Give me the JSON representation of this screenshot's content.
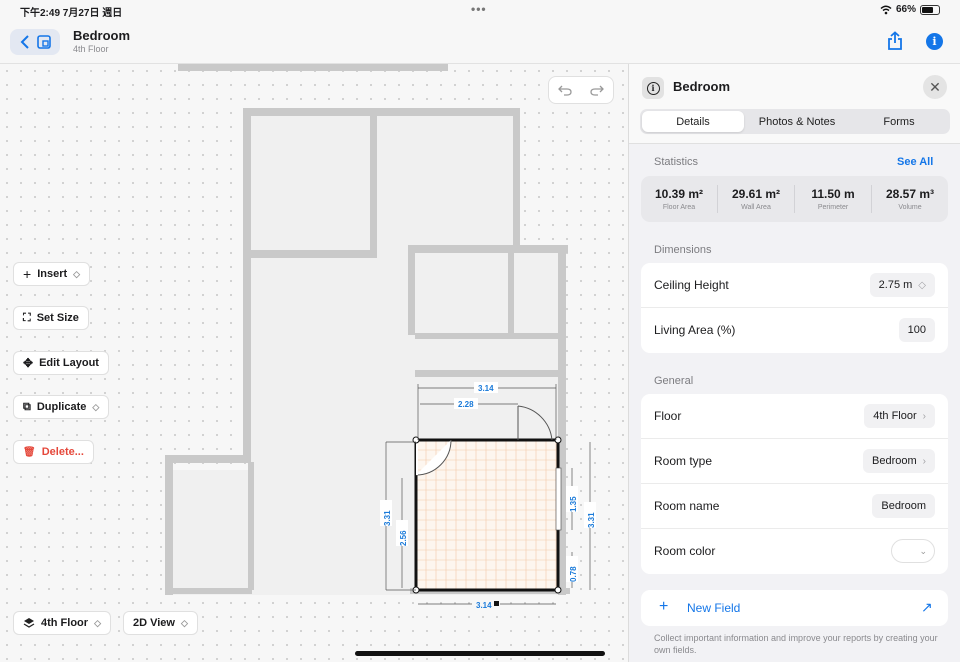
{
  "status_bar": {
    "time": "下午2:49  7月27日 週日",
    "dots": "•••",
    "battery": "66%",
    "battery_level": 0.66
  },
  "nav": {
    "title": "Bedroom",
    "subtitle": "4th Floor",
    "back_icon": "chevron-left-icon",
    "plan_icon": "floorplan-icon",
    "share_icon": "share-icon",
    "info_icon": "info-icon",
    "info_glyph": "i",
    "accent": "#1476e8"
  },
  "canvas": {
    "tools": [
      {
        "label": "Insert",
        "icon": "plus-icon",
        "glyph": "+",
        "chevron": true
      },
      {
        "label": "Set Size",
        "icon": "resize-icon",
        "glyph": "⛶",
        "chevron": false
      },
      {
        "label": "Edit Layout",
        "icon": "move-icon",
        "glyph": "✥",
        "chevron": false
      },
      {
        "label": "Duplicate",
        "icon": "duplicate-icon",
        "glyph": "⧉",
        "chevron": true
      },
      {
        "label": "Delete...",
        "icon": "trash-icon",
        "glyph": "🗑",
        "chevron": false,
        "color": "#e5483b"
      }
    ],
    "floor_selector": "4th Floor",
    "view_selector": "2D View",
    "chevron_glyph": "◇",
    "dimensions": {
      "top_outer": "3.14",
      "top_inner": "2.28",
      "left_outer": "3.31",
      "left_inner": "2.56",
      "right_upper": "1.35",
      "right_outer": "3.31",
      "right_lower": "0.78",
      "bottom": "3.14"
    }
  },
  "panel": {
    "title": "Bedroom",
    "info_glyph": "i",
    "close_glyph": "✕",
    "tabs": [
      "Details",
      "Photos & Notes",
      "Forms"
    ],
    "active_tab": "Details",
    "statistics_label": "Statistics",
    "see_all": "See All",
    "stats": [
      {
        "value": "10.39 m²",
        "label": "Floor Area"
      },
      {
        "value": "29.61 m²",
        "label": "Wall Area"
      },
      {
        "value": "11.50 m",
        "label": "Perimeter"
      },
      {
        "value": "28.57 m³",
        "label": "Volume"
      }
    ],
    "dimensions_label": "Dimensions",
    "dimensions_rows": [
      {
        "key": "Ceiling Height",
        "value": "2.75 m",
        "chevron": "◇"
      },
      {
        "key": "Living Area (%)",
        "value": "100",
        "chevron": ""
      }
    ],
    "general_label": "General",
    "general_rows": [
      {
        "key": "Floor",
        "value": "4th Floor",
        "chevron": "›"
      },
      {
        "key": "Room type",
        "value": "Bedroom",
        "chevron": "›"
      },
      {
        "key": "Room name",
        "value": "Bedroom",
        "chevron": ""
      }
    ],
    "room_color_label": "Room color",
    "room_color_glyph": "⌄",
    "new_field": "New Field",
    "new_field_plus": "+",
    "new_field_arrow": "↗",
    "footnote": "Collect important information and improve your reports by creating your own fields."
  }
}
